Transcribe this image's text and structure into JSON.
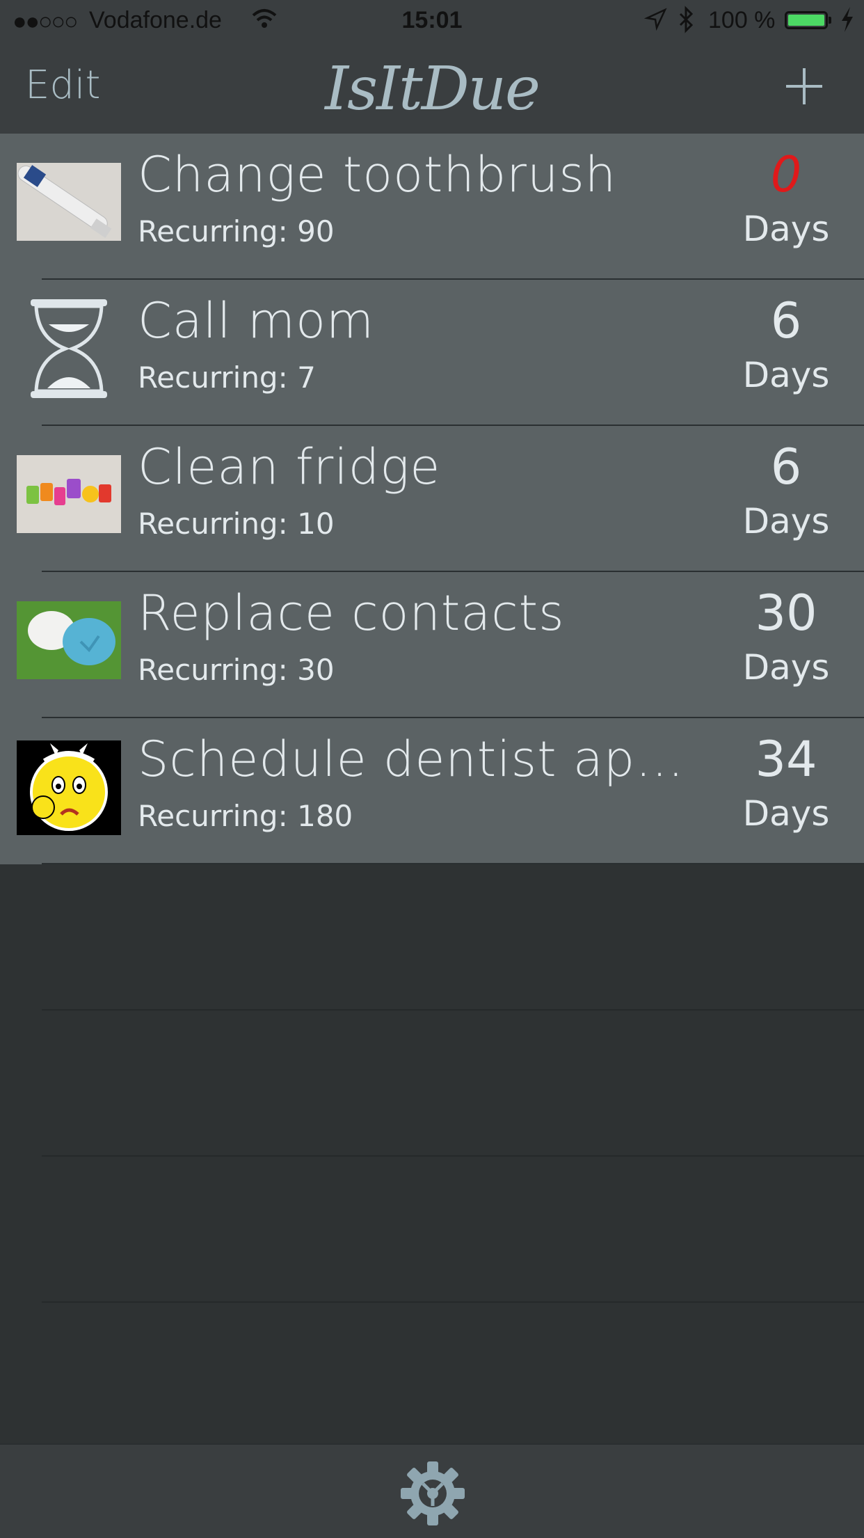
{
  "status_bar": {
    "signal": "●●○○○",
    "carrier": "Vodafone.de",
    "time": "15:01",
    "battery_percent": "100 %",
    "icons": [
      "wifi-icon",
      "location-icon",
      "bluetooth-icon",
      "battery-icon",
      "charging-icon"
    ]
  },
  "nav": {
    "edit_label": "Edit",
    "title": "IsItDue",
    "add_icon": "plus-icon"
  },
  "colors": {
    "row_background": "#5b6264",
    "page_background": "#2e3233",
    "bar_background": "#3a3e40",
    "accent": "#a9bcc4",
    "overdue": "#e0191a"
  },
  "tasks": [
    {
      "title": "Change toothbrush",
      "recurring": "Recurring:  90",
      "count": "0",
      "days_label": "Days",
      "overdue": true,
      "thumbnail": "toothbrush-photo"
    },
    {
      "title": "Call mom",
      "recurring": "Recurring:  7",
      "count": "6",
      "days_label": "Days",
      "overdue": false,
      "thumbnail": "hourglass-icon"
    },
    {
      "title": "Clean fridge",
      "recurring": "Recurring:  10",
      "count": "6",
      "days_label": "Days",
      "overdue": false,
      "thumbnail": "fridge-magnets-photo"
    },
    {
      "title": "Replace contacts",
      "recurring": "Recurring:  30",
      "count": "30",
      "days_label": "Days",
      "overdue": false,
      "thumbnail": "contact-case-photo"
    },
    {
      "title": "Schedule dentist appointment",
      "recurring": "Recurring:  180",
      "count": "34",
      "days_label": "Days",
      "overdue": false,
      "thumbnail": "toothache-emoji"
    }
  ],
  "toolbar": {
    "settings_icon": "gear-icon"
  }
}
